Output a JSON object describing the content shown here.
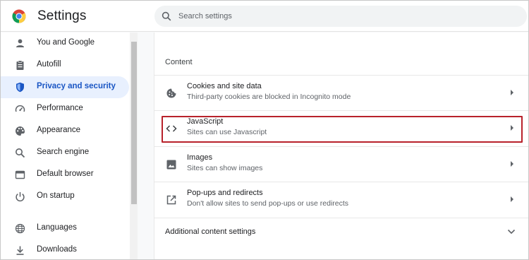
{
  "header": {
    "app_title": "Settings",
    "search_placeholder": "Search settings"
  },
  "sidebar": {
    "items": [
      {
        "label": "You and Google",
        "icon": "person-icon"
      },
      {
        "label": "Autofill",
        "icon": "clipboard-icon"
      },
      {
        "label": "Privacy and security",
        "icon": "shield-icon",
        "active": true
      },
      {
        "label": "Performance",
        "icon": "speedometer-icon"
      },
      {
        "label": "Appearance",
        "icon": "palette-icon"
      },
      {
        "label": "Search engine",
        "icon": "search-icon"
      },
      {
        "label": "Default browser",
        "icon": "browser-icon"
      },
      {
        "label": "On startup",
        "icon": "power-icon"
      },
      {
        "label": "Languages",
        "icon": "globe-icon"
      },
      {
        "label": "Downloads",
        "icon": "download-icon"
      }
    ]
  },
  "main": {
    "section_title": "Content",
    "rows": [
      {
        "title": "Cookies and site data",
        "subtitle": "Third-party cookies are blocked in Incognito mode",
        "icon": "cookie-icon"
      },
      {
        "title": "JavaScript",
        "subtitle": "Sites can use Javascript",
        "icon": "code-icon",
        "highlighted": true
      },
      {
        "title": "Images",
        "subtitle": "Sites can show images",
        "icon": "image-icon"
      },
      {
        "title": "Pop-ups and redirects",
        "subtitle": "Don't allow sites to send pop-ups or use redirects",
        "icon": "open-in-new-icon"
      }
    ],
    "more_label": "Additional content settings"
  },
  "colors": {
    "accent": "#1a73e8",
    "active_bg": "#e8f0fe",
    "highlight_border": "#b8222b"
  }
}
